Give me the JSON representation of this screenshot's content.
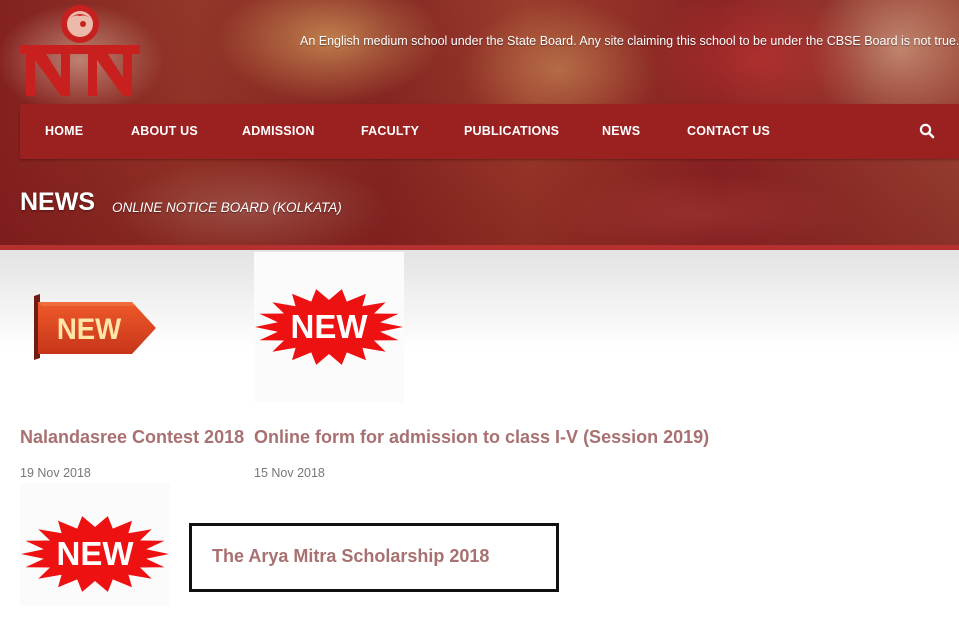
{
  "header": {
    "tagline": "An English medium school under the State Board. Any site claiming this school to be under the CBSE Board is not true."
  },
  "nav": {
    "items": [
      {
        "label": "HOME"
      },
      {
        "label": "ABOUT US"
      },
      {
        "label": "ADMISSION"
      },
      {
        "label": "FACULTY"
      },
      {
        "label": "PUBLICATIONS"
      },
      {
        "label": "NEWS"
      },
      {
        "label": "CONTACT US"
      }
    ],
    "search_icon": "search-icon"
  },
  "page": {
    "title": "NEWS",
    "subtitle": "ONLINE NOTICE BOARD (KOLKATA)"
  },
  "news": [
    {
      "title": "Nalandasree Contest 2018",
      "date": "19 Nov 2018",
      "badge_text": "NEW",
      "badge_style": "ribbon"
    },
    {
      "title": "Online form for admission to class I-V (Session 2019)",
      "date": "15 Nov 2018",
      "badge_text": "NEW",
      "badge_style": "starburst"
    },
    {
      "title": "The Arya Mitra Scholarship 2018",
      "badge_text": "NEW",
      "badge_style": "starburst"
    }
  ],
  "colors": {
    "brand_red": "#9b2121",
    "link_title": "#a87070",
    "badge_red": "#ee1111"
  }
}
